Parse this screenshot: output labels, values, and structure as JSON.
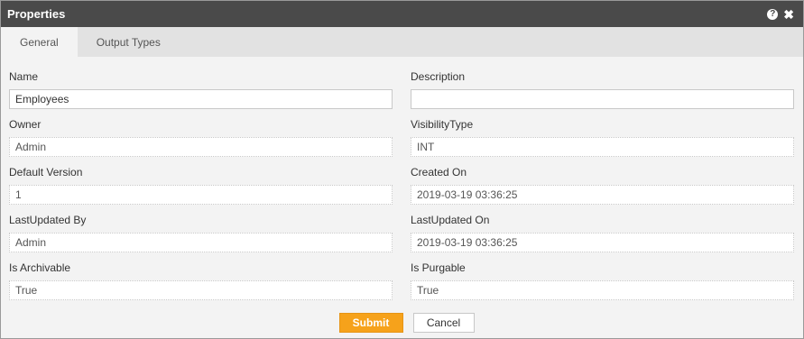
{
  "window": {
    "title": "Properties",
    "help_icon": "question-circle-icon",
    "close_icon": "close-icon",
    "help_glyph": "?",
    "close_glyph": "✖"
  },
  "tabs": [
    {
      "label": "General",
      "active": true
    },
    {
      "label": "Output Types",
      "active": false
    }
  ],
  "form": {
    "name": {
      "label": "Name",
      "value": "Employees"
    },
    "description": {
      "label": "Description",
      "value": ""
    },
    "owner": {
      "label": "Owner",
      "value": "Admin"
    },
    "visibility_type": {
      "label": "VisibilityType",
      "value": "INT"
    },
    "default_version": {
      "label": "Default Version",
      "value": "1"
    },
    "created_on": {
      "label": "Created On",
      "value": "2019-03-19 03:36:25"
    },
    "last_updated_by": {
      "label": "LastUpdated By",
      "value": "Admin"
    },
    "last_updated_on": {
      "label": "LastUpdated On",
      "value": "2019-03-19 03:36:25"
    },
    "is_archivable": {
      "label": "Is Archivable",
      "value": "True"
    },
    "is_purgable": {
      "label": "Is Purgable",
      "value": "True"
    }
  },
  "buttons": {
    "submit": "Submit",
    "cancel": "Cancel"
  },
  "colors": {
    "titlebar": "#4a4a4a",
    "accent": "#f6a21b",
    "tabbar": "#e2e2e2",
    "panel": "#f3f3f3"
  }
}
